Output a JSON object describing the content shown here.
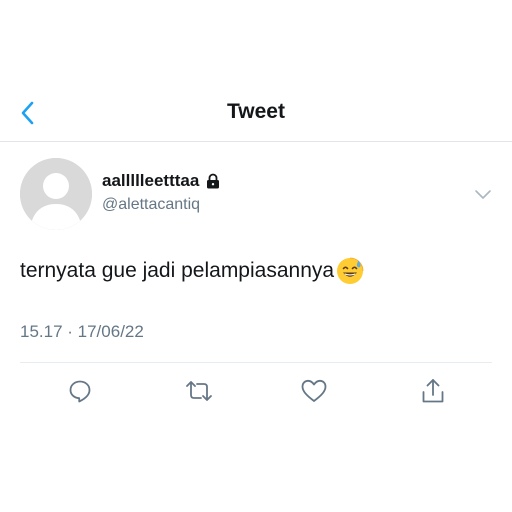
{
  "header": {
    "title": "Tweet",
    "back_icon": "chevron-left-icon",
    "accent_color": "#1da1f2"
  },
  "author": {
    "display_name": "aallllleetttaa",
    "handle": "@alettacantiq",
    "protected_icon": "lock-icon"
  },
  "tweet": {
    "text": "ternyata gue jadi pelampiasannya",
    "emoji_icon": "grinning-sweat-emoji-icon",
    "timestamp": "15.17 · 17/06/22"
  },
  "actions": [
    {
      "name": "reply",
      "icon": "reply-icon"
    },
    {
      "name": "retweet",
      "icon": "retweet-icon"
    },
    {
      "name": "like",
      "icon": "heart-icon"
    },
    {
      "name": "share",
      "icon": "share-icon"
    }
  ]
}
